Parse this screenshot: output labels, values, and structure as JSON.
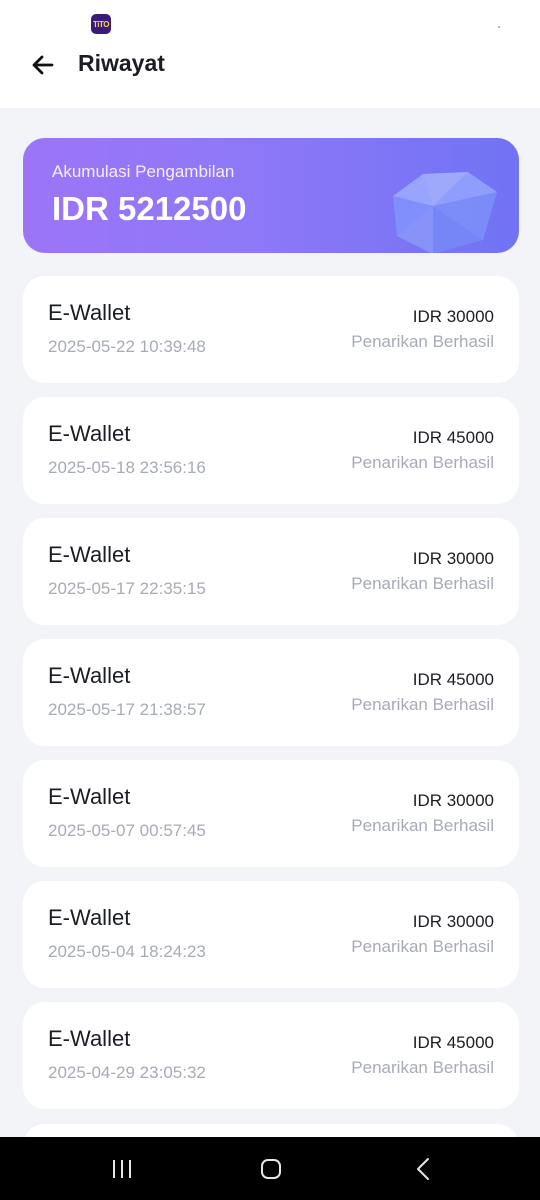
{
  "statusbar": {
    "app_icon_text": "TiTO"
  },
  "header": {
    "title": "Riwayat"
  },
  "summary": {
    "label": "Akumulasi Pengambilan",
    "value": "IDR 5212500"
  },
  "transactions": [
    {
      "title": "E-Wallet",
      "date": "2025-05-22 10:39:48",
      "amount": "IDR 30000",
      "status": "Penarikan Berhasil"
    },
    {
      "title": "E-Wallet",
      "date": "2025-05-18 23:56:16",
      "amount": "IDR 45000",
      "status": "Penarikan Berhasil"
    },
    {
      "title": "E-Wallet",
      "date": "2025-05-17 22:35:15",
      "amount": "IDR 30000",
      "status": "Penarikan Berhasil"
    },
    {
      "title": "E-Wallet",
      "date": "2025-05-17 21:38:57",
      "amount": "IDR 45000",
      "status": "Penarikan Berhasil"
    },
    {
      "title": "E-Wallet",
      "date": "2025-05-07 00:57:45",
      "amount": "IDR 30000",
      "status": "Penarikan Berhasil"
    },
    {
      "title": "E-Wallet",
      "date": "2025-05-04 18:24:23",
      "amount": "IDR 30000",
      "status": "Penarikan Berhasil"
    },
    {
      "title": "E-Wallet",
      "date": "2025-04-29 23:05:32",
      "amount": "IDR 45000",
      "status": "Penarikan Berhasil"
    }
  ],
  "icons": {
    "back": "arrow-left-icon",
    "summary": "diamond-icon",
    "nav_recent": "recent-apps-icon",
    "nav_home": "home-icon",
    "nav_back": "chevron-left-icon"
  },
  "colors": {
    "accent_gradient_start": "#9c75f7",
    "accent_gradient_end": "#6f73f4",
    "background": "#f3f4f8",
    "muted_text": "#a7abb6"
  }
}
